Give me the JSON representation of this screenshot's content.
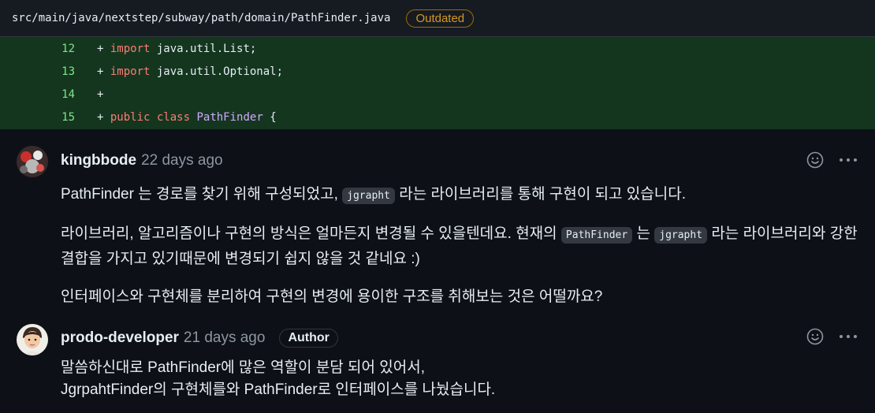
{
  "file": {
    "path": "src/main/java/nextstep/subway/path/domain/PathFinder.java",
    "status": "Outdated"
  },
  "diff": {
    "lines": [
      {
        "num": "12",
        "prefix": "+ ",
        "kw1": "import",
        "rest": " java.util.List;"
      },
      {
        "num": "13",
        "prefix": "+ ",
        "kw1": "import",
        "rest": " java.util.Optional;"
      },
      {
        "num": "14",
        "prefix": "+",
        "kw1": "",
        "rest": ""
      },
      {
        "num": "15",
        "prefix": "+ ",
        "kw1": "public",
        "kw2": "class",
        "cls": "PathFinder",
        "rest": " {"
      }
    ]
  },
  "comments": [
    {
      "author": "kingbbode",
      "time": "22 days ago",
      "p1_a": "PathFinder 는 경로를 찾기 위해 구성되었고, ",
      "p1_code": "jgrapht",
      "p1_b": " 라는 라이브러리를 통해 구현이 되고 있습니다.",
      "p2_a": "라이브러리, 알고리즘이나 구현의 방식은 얼마든지 변경될 수 있을텐데요. 현재의 ",
      "p2_code1": "PathFinder",
      "p2_b": " 는 ",
      "p2_code2": "jgrapht",
      "p2_c": " 라는 라이브러리와 강한 결합을 가지고 있기때문에 변경되기 쉽지 않을 것 같네요 :)",
      "p3": "인터페이스와 구현체를 분리하여 구현의 변경에 용이한 구조를 취해보는 것은 어떨까요?"
    },
    {
      "author": "prodo-developer",
      "time": "21 days ago",
      "badge": "Author",
      "line1": "말씀하신대로 PathFinder에 많은 역할이 분담 되어 있어서,",
      "line2": "JgrpahtFinder의 구현체를와 PathFinder로 인터페이스를 나눴습니다."
    }
  ]
}
